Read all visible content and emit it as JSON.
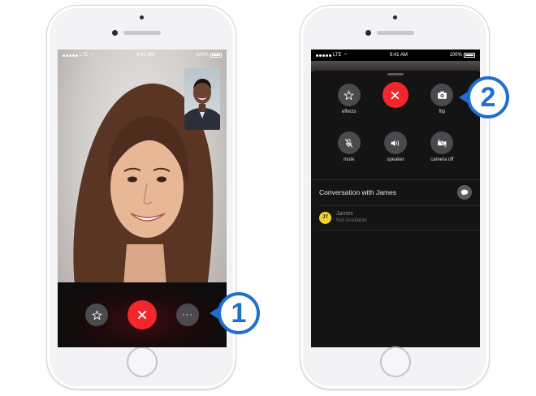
{
  "status_bar": {
    "carrier": "LTE",
    "time": "9:41 AM",
    "battery": "100%"
  },
  "left_phone": {
    "controls": {
      "effects_icon": "star-effects-icon",
      "end_icon": "close-x-icon",
      "more_label": "···"
    }
  },
  "right_phone": {
    "controls": [
      {
        "icon": "star-effects-icon",
        "label": "effects"
      },
      {
        "icon": "close-x-icon",
        "label": ""
      },
      {
        "icon": "camera-flip-icon",
        "label": "flip"
      },
      {
        "icon": "mute-mic-icon",
        "label": "mute"
      },
      {
        "icon": "speaker-icon",
        "label": "speaker"
      },
      {
        "icon": "camera-off-icon",
        "label": "camera off"
      }
    ],
    "conversation_title": "Conversation with James",
    "contact": {
      "initials": "JT",
      "name": "James",
      "status": "Not Available"
    }
  },
  "callouts": {
    "first": "1",
    "second": "2"
  },
  "colors": {
    "end_call_red": "#f3262c",
    "callout_blue": "#1f6fd0",
    "avatar_yellow": "#f2d52c"
  }
}
